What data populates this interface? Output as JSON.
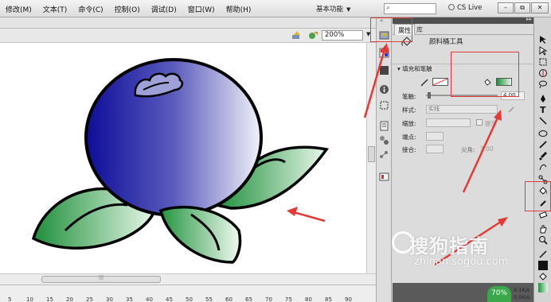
{
  "menu": {
    "items": [
      "修改(M)",
      "文本(T)",
      "命令(C)",
      "控制(O)",
      "调试(D)",
      "窗口(W)",
      "帮助(H)"
    ],
    "workspace_label": "基本功能",
    "cs_live_label": "CS Live",
    "window_buttons": [
      "–",
      "⧉",
      "✕"
    ]
  },
  "stage": {
    "zoom_value": "200%"
  },
  "ruler": {
    "ticks": [
      "5",
      "10",
      "15",
      "20",
      "25",
      "30",
      "35",
      "40",
      "45",
      "50",
      "55",
      "60",
      "65",
      "70",
      "75",
      "80",
      "85",
      "90"
    ]
  },
  "properties_panel": {
    "tab_properties": "属性",
    "tab_library": "库",
    "tool_name": "颜料桶工具",
    "section_fill_stroke": "填充和笔触",
    "stroke_label": "笔触:",
    "stroke_value": "4.00",
    "style_label": "样式:",
    "style_value": "实线",
    "scale_label": "缩放:",
    "hint_label": "提示",
    "cap_label": "端点:",
    "join_label": "接合:",
    "miter_label": "尖角:",
    "miter_value": "3.00"
  },
  "colors": {
    "fill_gradient_start": "#1e8f3a",
    "fill_gradient_end": "#e8f7ea",
    "berry_dark": "#0d0d99",
    "berry_light": "#f2f2fa",
    "highlight_red": "#e53935"
  },
  "watermark": {
    "brand": "搜狗指南",
    "url": "zhinan.sogou.com"
  },
  "network": {
    "percent": "70%",
    "up": "0.1K/s",
    "down": "0.5K/s"
  }
}
